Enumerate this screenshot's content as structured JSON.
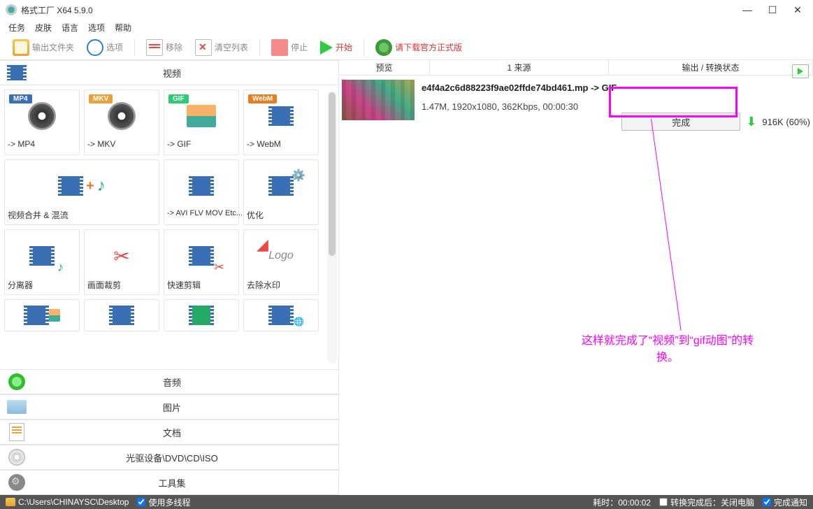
{
  "window": {
    "title": "格式工厂 X64 5.9.0"
  },
  "menus": {
    "task": "任务",
    "skin": "皮肤",
    "lang": "语言",
    "option": "选项",
    "help": "帮助"
  },
  "toolbar": {
    "output_folder": "输出文件夹",
    "options": "选项",
    "remove": "移除",
    "clear_list": "清空列表",
    "stop": "停止",
    "start": "开始",
    "download_note": "请下载官方正式版"
  },
  "cats": {
    "video": "视频",
    "audio": "音频",
    "image": "图片",
    "document": "文档",
    "optical": "光驱设备\\DVD\\CD\\ISO",
    "toolset": "工具集"
  },
  "tiles": {
    "mp4": "-> MP4",
    "mkv": "-> MKV",
    "gif": "-> GIF",
    "webm": "-> WebM",
    "merge": "视频合并 & 混流",
    "avi_etc": "-> AVI FLV MOV Etc...",
    "optimize": "优化",
    "splitter": "分离器",
    "crop": "画面裁剪",
    "fastclip": "快速剪辑",
    "dewm": "去除水印"
  },
  "right": {
    "hdr_preview": "预览",
    "hdr_source": "1 来源",
    "hdr_output": "输出 / 转换状态",
    "filename": "e4f4a2c6d88223f9ae02ffde74bd461.mp -> GIF",
    "fileinfo": "1.47M, 1920x1080, 362Kbps, 00:00:30",
    "done": "完成",
    "size": "916K (60%)"
  },
  "annotation": {
    "text1": "这样就完成了“视频”到“gif动图”的转换。"
  },
  "status": {
    "path": "C:\\Users\\CHINAYSC\\Desktop",
    "multithread": "使用多线程",
    "elapsed": "耗时：00:00:02",
    "after": "转换完成后：关闭电脑",
    "notify": "完成通知"
  }
}
